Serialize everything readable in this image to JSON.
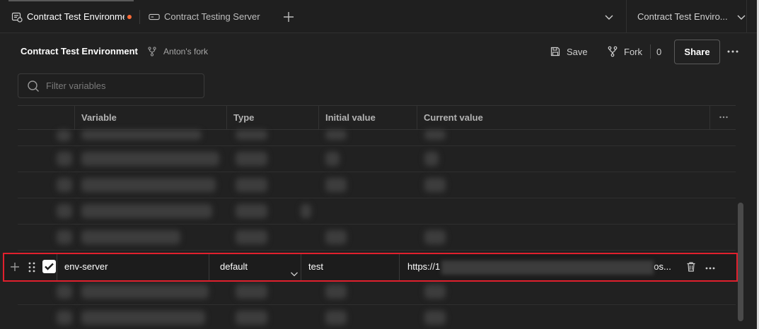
{
  "tabs": [
    {
      "label": "Contract Test Environment",
      "unsaved": true
    },
    {
      "label": "Contract Testing Server"
    }
  ],
  "env_selector": {
    "label": "Contract Test Enviro..."
  },
  "header": {
    "title": "Contract Test Environment",
    "fork_label": "Anton's fork",
    "save_label": "Save",
    "fork_button_label": "Fork",
    "fork_count": "0",
    "share_label": "Share"
  },
  "filter": {
    "placeholder": "Filter variables"
  },
  "table": {
    "columns": [
      "Variable",
      "Type",
      "Initial value",
      "Current value"
    ],
    "highlighted_row": {
      "variable": "env-server",
      "enabled": true,
      "type": "default",
      "initial_value": "test",
      "current_value_prefix": "https://1",
      "current_value_suffix": "os..."
    }
  },
  "colors": {
    "accent": "#ff6c37",
    "highlight_border": "#e0202d",
    "background": "#212121"
  }
}
